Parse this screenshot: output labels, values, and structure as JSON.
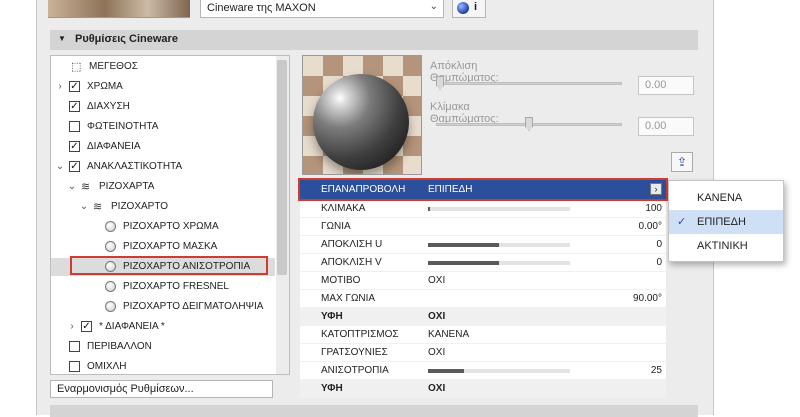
{
  "engine_select": {
    "value": "Cineware της MAXON"
  },
  "info_button": {
    "label": "i"
  },
  "section": {
    "title": "Ρυθμίσεις Cineware"
  },
  "tree": [
    {
      "label": "ΜΕΓΕΘΟΣ",
      "kind": "size-icon",
      "expander": "",
      "checked": ""
    },
    {
      "label": "ΧΡΩΜΑ",
      "kind": "checkbox",
      "expander": "›",
      "checked": "✓"
    },
    {
      "label": "ΔΙΑΧΥΣΗ",
      "kind": "checkbox",
      "expander": "",
      "checked": "✓"
    },
    {
      "label": "ΦΩΤΕΙΝΟΤΗΤΑ",
      "kind": "checkbox",
      "expander": "",
      "checked": ""
    },
    {
      "label": "ΔΙΑΦΑΝΕΙΑ",
      "kind": "checkbox",
      "expander": "",
      "checked": "✓"
    },
    {
      "label": "ΑΝΑΚΛΑΣΤΙΚΟΤΗΤΑ",
      "kind": "checkbox",
      "expander": "⌄",
      "checked": "✓"
    },
    {
      "label": "ΡΙΖΟΧΑΡΤΑ",
      "kind": "layer",
      "expander": "⌄",
      "checked": ""
    },
    {
      "label": "ΡΙΖΟΧΑΡΤΟ",
      "kind": "layer",
      "expander": "⌄",
      "checked": ""
    },
    {
      "label": "ΡΙΖΟΧΑΡΤΟ ΧΡΩΜΑ",
      "kind": "radio",
      "expander": "",
      "checked": ""
    },
    {
      "label": "ΡΙΖΟΧΑΡΤΟ ΜΑΣΚΑ",
      "kind": "radio",
      "expander": "",
      "checked": ""
    },
    {
      "label": "ΡΙΖΟΧΑΡΤΟ ΑΝΙΣΟΤΡΟΠΙΑ",
      "kind": "radio",
      "expander": "",
      "checked": ""
    },
    {
      "label": "ΡΙΖΟΧΑΡΤΟ FRESNEL",
      "kind": "radio",
      "expander": "",
      "checked": ""
    },
    {
      "label": "ΡΙΖΟΧΑΡΤΟ ΔΕΙΓΜΑΤΟΛΗΨΙΑ",
      "kind": "radio",
      "expander": "",
      "checked": ""
    },
    {
      "label": "* ΔΙΑΦΑΝΕΙΑ *",
      "kind": "checkbox",
      "expander": "›",
      "checked": "✓"
    },
    {
      "label": "ΠΕΡΙΒΑΛΛΟΝ",
      "kind": "checkbox",
      "expander": "",
      "checked": ""
    },
    {
      "label": "ΟΜΙΧΛΗ",
      "kind": "checkbox",
      "expander": "",
      "checked": ""
    }
  ],
  "adapt_settings": {
    "label": "Εναρμονισμός Ρυθμίσεων..."
  },
  "sliders": [
    {
      "label": "Απόκλιση Θαμπώματος:",
      "value": "0.00",
      "level": 0.0
    },
    {
      "label": "Κλίμακα Θαμπώματος:",
      "value": "0.00",
      "level": 0.5
    }
  ],
  "properties": {
    "top": {
      "name": "ΕΠΑΝΑΠΡΟΒΟΛΗ",
      "value": "ΕΠΙΠΕΔΗ",
      "arrow": "›"
    },
    "rows": [
      {
        "name": "ΚΛΙΜΑΚΑ",
        "value": "",
        "num": "100",
        "bar": 0.01,
        "header": false
      },
      {
        "name": "ΓΩΝΙΑ",
        "value": "",
        "num": "0.00°",
        "bar": -1,
        "header": false
      },
      {
        "name": "ΑΠΟΚΛΙΣΗ U",
        "value": "",
        "num": "0",
        "bar": 0.5,
        "header": false
      },
      {
        "name": "ΑΠΟΚΛΙΣΗ V",
        "value": "",
        "num": "0",
        "bar": 0.5,
        "header": false
      },
      {
        "name": "ΜΟΤΙΒΟ",
        "value": "ΟΧΙ",
        "num": "",
        "bar": -1,
        "header": false
      },
      {
        "name": "ΜΑΧ ΓΩΝΙΑ",
        "value": "",
        "num": "90.00°",
        "bar": -1,
        "header": false
      },
      {
        "name": "ΥΦΗ",
        "value": "ΟΧΙ",
        "num": "",
        "bar": -1,
        "header": true
      },
      {
        "name": "ΚΑΤΟΠΤΡΙΣΜΟΣ",
        "value": "ΚΑΝΕΝΑ",
        "num": "",
        "bar": -1,
        "header": false
      },
      {
        "name": "ΓΡΑΤΣΟΥΝΙΕΣ",
        "value": "ΟΧΙ",
        "num": "",
        "bar": -1,
        "header": false
      },
      {
        "name": "ΑΝΙΣΟΤΡΟΠΙΑ",
        "value": "",
        "num": "25",
        "bar": 0.25,
        "header": false
      },
      {
        "name": "ΥΦΗ",
        "value": "ΟΧΙ",
        "num": "",
        "bar": -1,
        "header": true
      }
    ]
  },
  "menu": {
    "items": [
      {
        "label": "ΚΑΝΕΝΑ",
        "selected": false,
        "check": ""
      },
      {
        "label": "ΕΠΙΠΕΔΗ",
        "selected": true,
        "check": "✓"
      },
      {
        "label": "ΑΚΤΙΝΙΚΗ",
        "selected": false,
        "check": ""
      }
    ]
  },
  "icons": {
    "export": "export-icon",
    "size": "size-icon"
  }
}
